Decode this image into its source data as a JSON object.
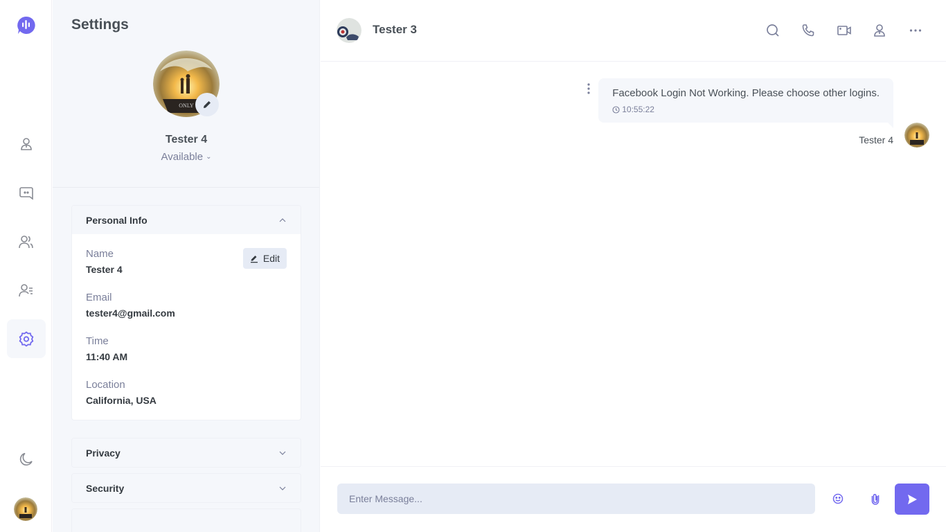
{
  "rail": {
    "logo": "chat-logo-icon",
    "items": [
      {
        "name": "profile",
        "icon": "user-icon",
        "active": false
      },
      {
        "name": "chats",
        "icon": "message-icon",
        "active": false
      },
      {
        "name": "groups",
        "icon": "group-icon",
        "active": false
      },
      {
        "name": "contacts",
        "icon": "contacts-icon",
        "active": false
      },
      {
        "name": "settings",
        "icon": "gear-icon",
        "active": true
      }
    ],
    "theme_toggle": "moon-icon"
  },
  "settings": {
    "title": "Settings",
    "profile": {
      "name": "Tester 4",
      "status": "Available"
    },
    "personal_info": {
      "header": "Personal Info",
      "edit_label": "Edit",
      "fields": [
        {
          "label": "Name",
          "value": "Tester 4"
        },
        {
          "label": "Email",
          "value": "tester4@gmail.com"
        },
        {
          "label": "Time",
          "value": "11:40 AM"
        },
        {
          "label": "Location",
          "value": "California, USA"
        }
      ]
    },
    "sections": [
      {
        "header": "Privacy"
      },
      {
        "header": "Security"
      }
    ]
  },
  "chat": {
    "contact_name": "Tester 3",
    "header_icons": [
      "search-icon",
      "phone-icon",
      "video-icon",
      "user-icon",
      "more-icon"
    ],
    "messages": [
      {
        "text": "Facebook Login Not Working. Please choose other logins.",
        "time": "10:55:22",
        "author": "Tester 4"
      }
    ],
    "composer": {
      "placeholder": "Enter Message...",
      "value": ""
    }
  },
  "colors": {
    "accent": "#7269ef",
    "panel_bg": "#f5f7fb",
    "input_bg": "#e6ebf5",
    "text": "#495057",
    "muted": "#7a7f9a"
  }
}
